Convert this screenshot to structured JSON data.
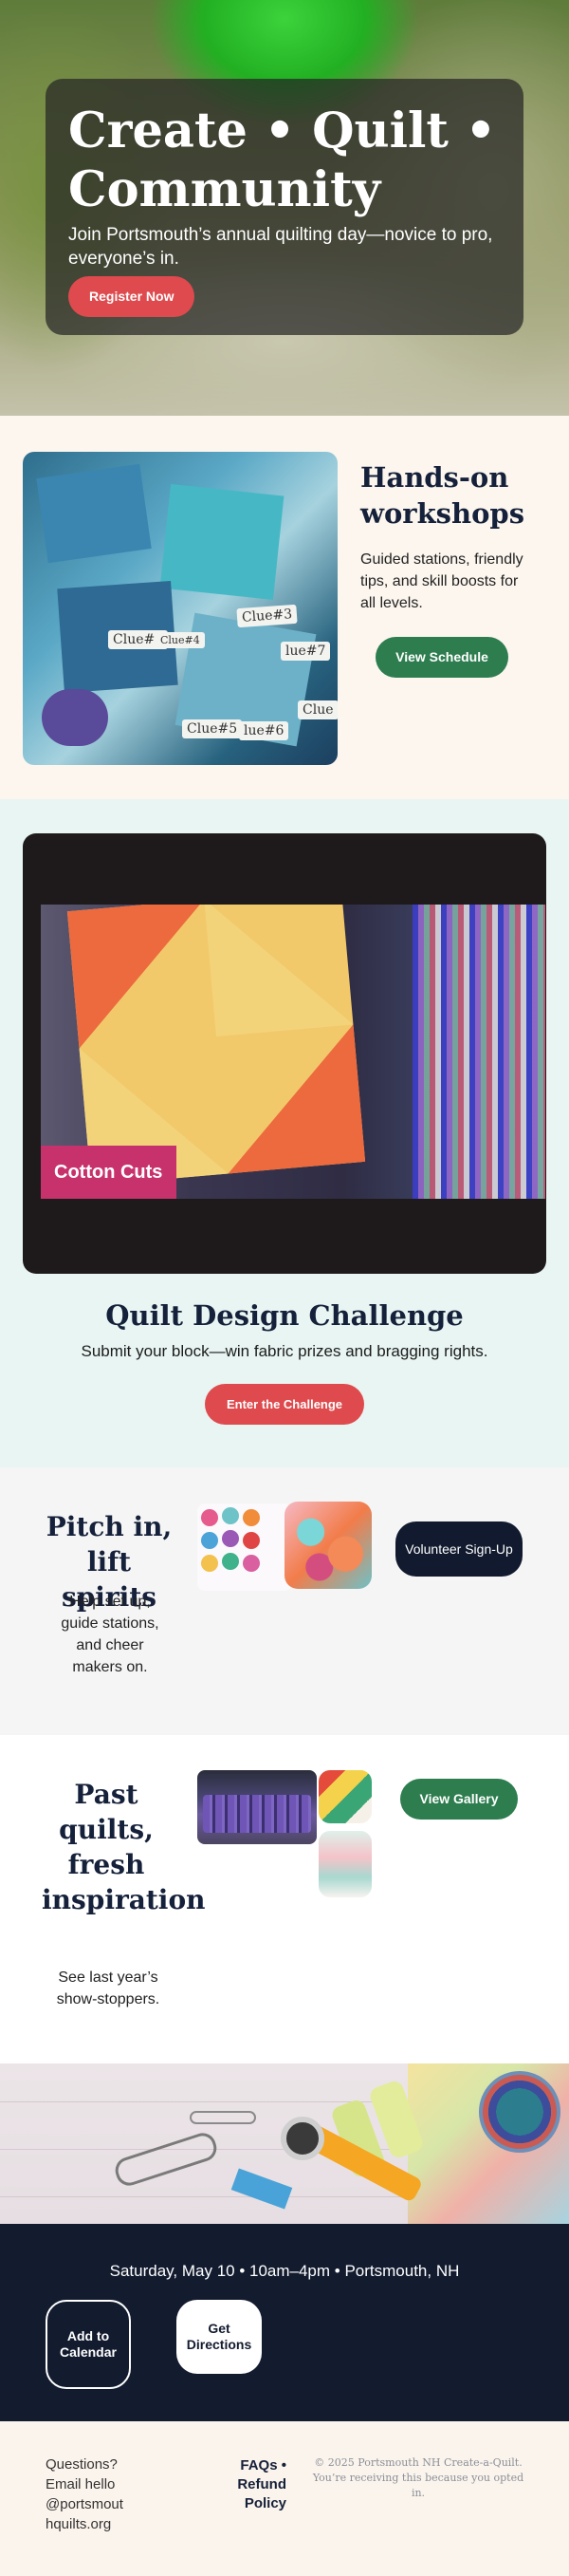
{
  "hero": {
    "title": "Create • Quilt • Community",
    "subtitle": "Join Portsmouth’s annual quilting day—novice to pro, everyone’s in.",
    "cta": "Register Now"
  },
  "workshops": {
    "title": "Hands-on workshops",
    "text": "Guided stations, friendly tips, and skill boosts for all levels.",
    "cta": "View Schedule",
    "clues": [
      "Clue#1",
      "Clue#3",
      "Clue#4",
      "lue#7",
      "Clue#5",
      "lue#6",
      "Clue"
    ]
  },
  "challenge": {
    "video_label": "Cotton Cuts",
    "title": "Quilt Design Challenge",
    "text": "Submit your block—win fabric prizes and bragging rights.",
    "cta": "Enter the Challenge"
  },
  "volunteer": {
    "title": "Pitch in, lift spirits",
    "text": "Help set up, guide stations, and cheer makers on.",
    "cta": "Volunteer Sign-Up"
  },
  "gallery": {
    "title": "Past quilts, fresh inspiration",
    "text": "See last year’s show-stoppers.",
    "cta": "View Gallery"
  },
  "event": {
    "details": "Saturday, May 10 • 10am–4pm • Portsmouth, NH",
    "calendar_cta": "Add to Calendar",
    "directions_cta": "Get Directions"
  },
  "footer": {
    "questions": "Questions? Email hello@portsmouthquilts.org",
    "faqs": "FAQs •",
    "refund": "Refund Policy",
    "legal": "© 2025 Portsmouth NH Create-a-Quilt. You’re receiving this because you opted in."
  },
  "colors": {
    "accent_red": "#de4a4d",
    "accent_green": "#2d7d4f",
    "navy": "#131b2f",
    "cotton_cuts_pink": "#c7326d"
  }
}
